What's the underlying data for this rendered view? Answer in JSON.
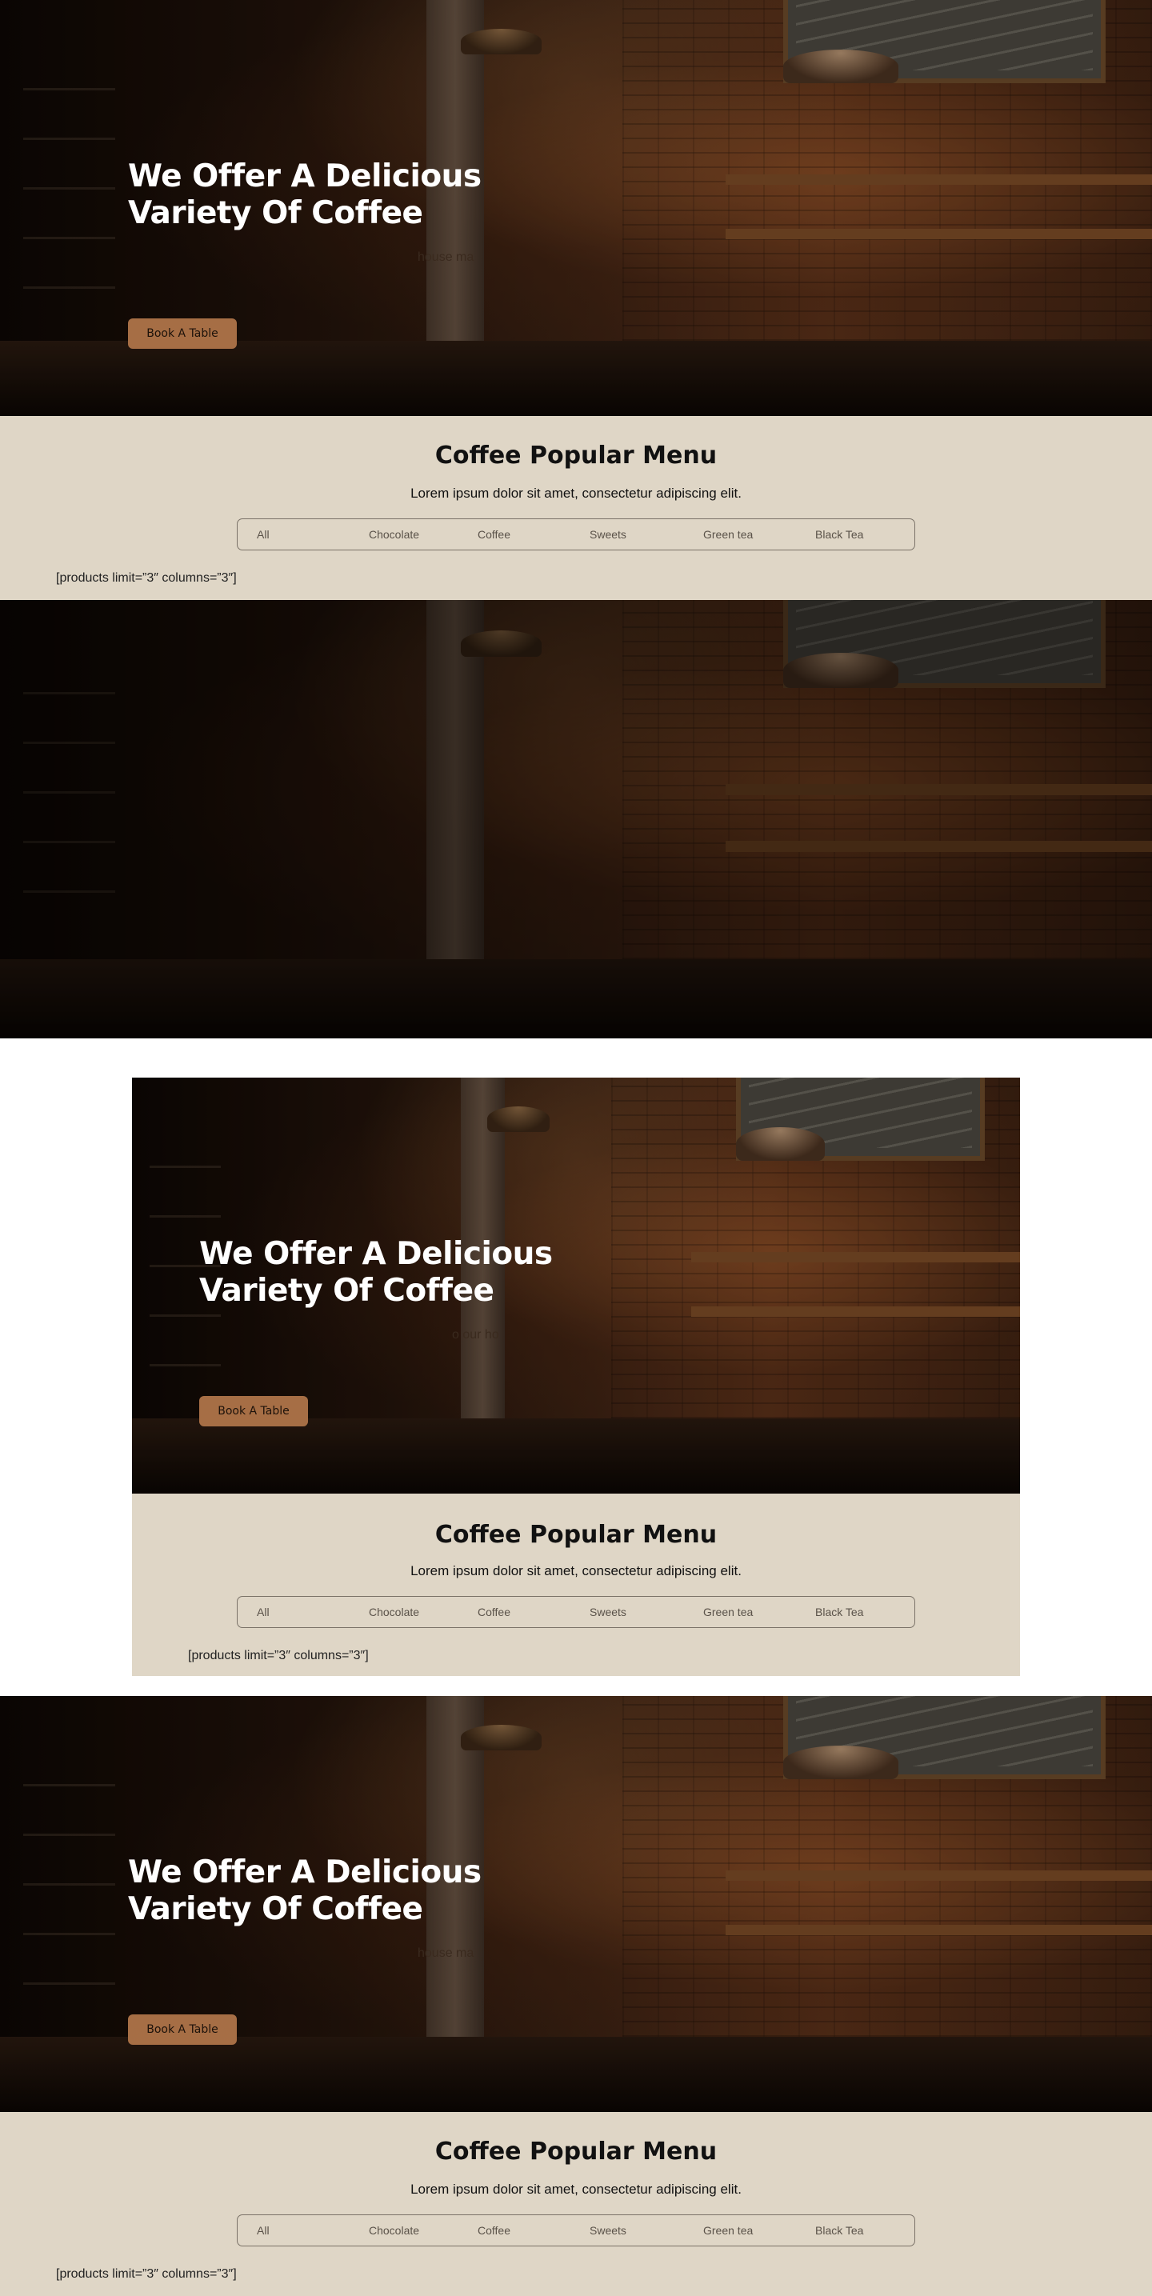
{
  "hero": {
    "title_line1": "We Offer A Delicious",
    "title_line2": "Variety Of Coffee",
    "tagline_fragment": "house ma",
    "book_button": "Book A Table"
  },
  "hero_boxed": {
    "title_line1": "We Offer A Delicious",
    "title_line2": "Variety Of Coffee",
    "tagline_fragment": "o our ho",
    "book_button": "Book A Table"
  },
  "menu": {
    "title": "Coffee Popular Menu",
    "subtitle": "Lorem ipsum dolor sit amet, consectetur adipiscing elit.",
    "tabs": [
      "All",
      "Chocolate",
      "Coffee",
      "Sweets",
      "Green tea",
      "Black Tea"
    ],
    "shortcode": "[products limit=”3″ columns=”3″]"
  },
  "colors": {
    "accent_button": "#a66e45",
    "menu_background": "#dfd6c6",
    "hero_title": "#ffffff"
  }
}
